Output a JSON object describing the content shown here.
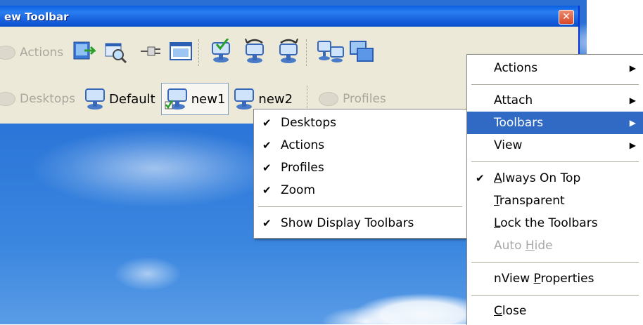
{
  "window": {
    "title": "ew Toolbar",
    "close_glyph": "✕"
  },
  "toolbar_actions": {
    "label": "Actions"
  },
  "toolbar_desktops": {
    "label": "Desktops",
    "items": [
      {
        "label": "Default"
      },
      {
        "label": "new1",
        "active": true
      },
      {
        "label": "new2"
      }
    ]
  },
  "toolbar_profiles": {
    "label": "Profiles"
  },
  "submenu_toolbars": {
    "items": [
      {
        "label": "Desktops",
        "checked": true
      },
      {
        "label": "Actions",
        "checked": true
      },
      {
        "label": "Profiles",
        "checked": true
      },
      {
        "label": "Zoom",
        "checked": true
      },
      {
        "label": "Show Display Toolbars",
        "checked": true
      }
    ]
  },
  "context_menu": {
    "items": [
      {
        "label": "Actions",
        "submenu": true
      },
      {
        "label": "Attach",
        "submenu": true
      },
      {
        "label": "Toolbars",
        "submenu": true,
        "highlighted": true
      },
      {
        "label": "View",
        "submenu": true
      },
      {
        "label": "Always On Top",
        "checked": true,
        "mnemonic": "A",
        "rest": "lways On Top"
      },
      {
        "label": "Transparent",
        "mnemonic": "T",
        "rest": "ransparent"
      },
      {
        "label": "Lock the Toolbars",
        "mnemonic": "L",
        "rest": "ock the Toolbars"
      },
      {
        "label": "Auto Hide",
        "disabled": true,
        "pre": "Auto ",
        "mnemonic": "H",
        "rest": "ide"
      },
      {
        "label": "nView Properties",
        "pre": "nView ",
        "mnemonic": "P",
        "rest": "roperties"
      },
      {
        "label": "Close",
        "mnemonic": "C",
        "rest": "lose"
      }
    ]
  },
  "glyphs": {
    "check": "✔",
    "arrow": "▶"
  },
  "colors": {
    "highlight": "#316ac5",
    "titlebar": "#0a5fe0",
    "toolbar_bg": "#ece9d8",
    "sky": "#2b76d8"
  }
}
